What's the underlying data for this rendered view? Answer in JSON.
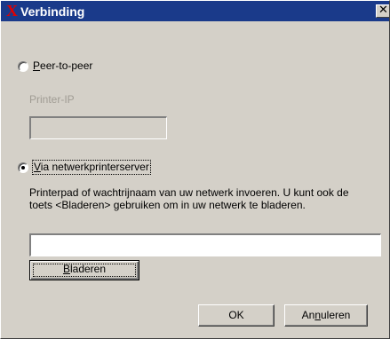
{
  "window": {
    "logo": "X",
    "title": "Verbinding",
    "close_glyph": "✕",
    "close_icon": "close-icon"
  },
  "options": {
    "peer": {
      "label_first": "P",
      "label_rest": "eer-to-peer",
      "selected": false
    },
    "printer_ip": {
      "label": "Printer-IP",
      "value": "",
      "enabled": false
    },
    "server": {
      "label_first": "V",
      "label_rest": "ia netwerkprinterserver",
      "selected": true
    }
  },
  "server_section": {
    "description": "Printerpad of wachtrijnaam van uw netwerk invoeren. U kunt ook de toets <Bladeren> gebruiken om in uw netwerk te bladeren.",
    "path_value": "",
    "browse_label_first": "B",
    "browse_label_rest": "laderen"
  },
  "footer": {
    "ok_label": "OK",
    "cancel_before": "An",
    "cancel_underlined": "n",
    "cancel_after": "uleren"
  },
  "colors": {
    "titlebar": "#1a3a8a",
    "dialog": "#d4d0c8",
    "logo": "#e00000"
  }
}
